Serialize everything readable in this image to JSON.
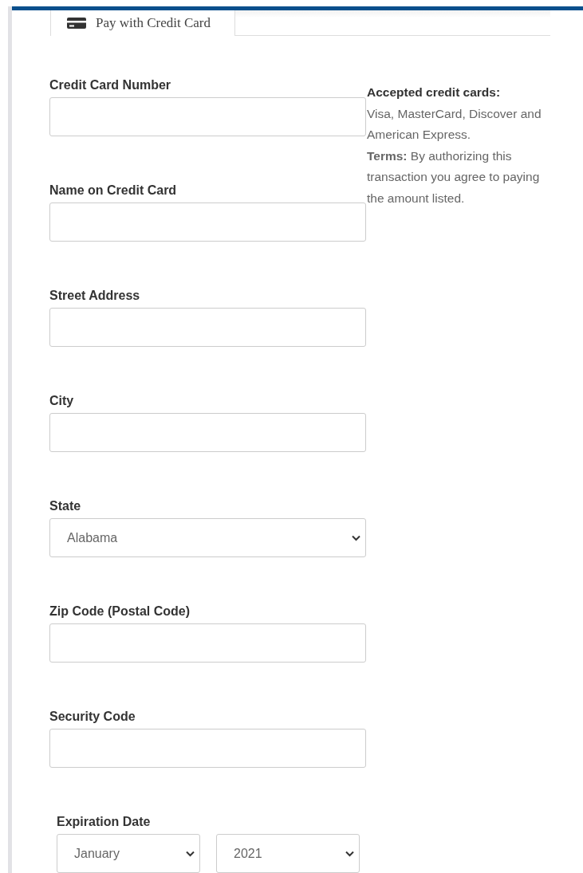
{
  "tab": {
    "label": "Pay with Credit Card",
    "selected": true
  },
  "fields": [
    {
      "kind": "text",
      "label": "Credit Card Number"
    },
    {
      "kind": "text",
      "label": "Name on Credit Card"
    },
    {
      "kind": "text",
      "label": "Street Address"
    },
    {
      "kind": "text",
      "label": "City"
    },
    {
      "kind": "select",
      "label": "State",
      "value": "Alabama"
    },
    {
      "kind": "text",
      "label": "Zip Code (Postal Code)"
    },
    {
      "kind": "text",
      "label": "Security Code"
    }
  ],
  "info": {
    "heading": "Accepted credit cards:",
    "text": "Visa, MasterCard, Discover and American Express.",
    "terms": "**Terms:** By authorizing this transaction you agree to paying the amount listed."
  },
  "expiration": {
    "label": "Expiration Date",
    "month": "January",
    "year": "2021"
  }
}
